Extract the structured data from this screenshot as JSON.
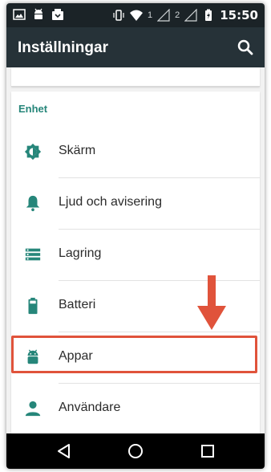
{
  "status_bar": {
    "sim1": "1",
    "sim2": "2",
    "battery_text": "",
    "time": "15:50"
  },
  "app_bar": {
    "title": "Inställningar",
    "search_icon": "search-icon"
  },
  "section": {
    "header": "Enhet"
  },
  "settings_items": [
    {
      "label": "Skärm",
      "icon": "brightness-icon"
    },
    {
      "label": "Ljud och avisering",
      "icon": "bell-icon"
    },
    {
      "label": "Lagring",
      "icon": "storage-icon"
    },
    {
      "label": "Batteri",
      "icon": "battery-icon"
    },
    {
      "label": "Appar",
      "icon": "android-icon"
    },
    {
      "label": "Användare",
      "icon": "person-icon"
    }
  ],
  "colors": {
    "status_bar": "#1b2327",
    "app_bar": "#263238",
    "accent": "#26867a",
    "highlight": "#e0533b"
  },
  "annotation": {
    "highlighted_item": "Appar",
    "arrow": "down-arrow-icon"
  },
  "nav_bar": {
    "back": "back-icon",
    "home": "home-icon",
    "recents": "recents-icon"
  }
}
